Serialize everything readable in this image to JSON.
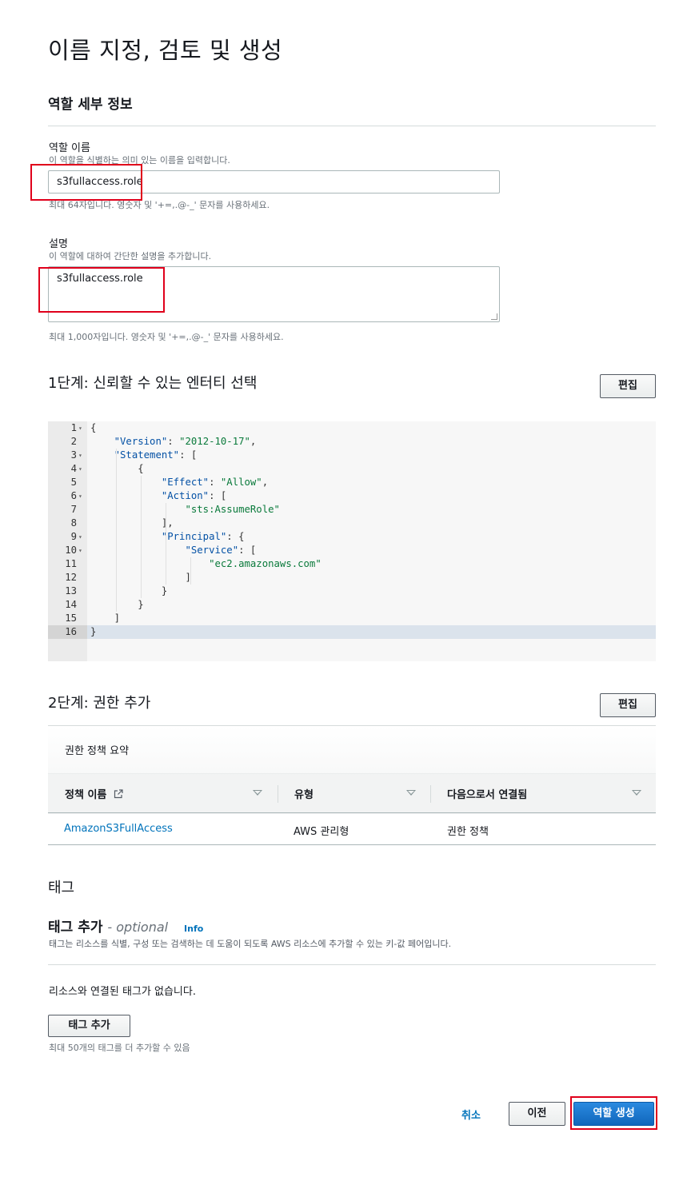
{
  "page_title": "이름 지정, 검토 및 생성",
  "role_details": {
    "heading": "역할 세부 정보",
    "name_label": "역할 이름",
    "name_desc": "이 역할을 식별하는 의미 있는 이름을 입력합니다.",
    "name_value": "s3fullaccess.role",
    "name_hint": "최대 64자입니다. 영숫자 및 '+=,.@-_' 문자를 사용하세요.",
    "desc_label": "설명",
    "desc_desc": "이 역할에 대하여 간단한 설명을 추가합니다.",
    "desc_value": "s3fullaccess.role",
    "desc_hint": "최대 1,000자입니다. 영숫자 및 '+=,.@-_' 문자를 사용하세요."
  },
  "step1": {
    "title": "1단계: 신뢰할 수 있는 엔터티 선택",
    "edit_label": "편집",
    "code_lines": [
      {
        "n": "1",
        "fold": true,
        "text": "{"
      },
      {
        "n": "2",
        "fold": false,
        "text": "    \"Version\": \"2012-10-17\","
      },
      {
        "n": "3",
        "fold": true,
        "text": "    \"Statement\": ["
      },
      {
        "n": "4",
        "fold": true,
        "text": "        {"
      },
      {
        "n": "5",
        "fold": false,
        "text": "            \"Effect\": \"Allow\","
      },
      {
        "n": "6",
        "fold": true,
        "text": "            \"Action\": ["
      },
      {
        "n": "7",
        "fold": false,
        "text": "                \"sts:AssumeRole\""
      },
      {
        "n": "8",
        "fold": false,
        "text": "            ],"
      },
      {
        "n": "9",
        "fold": true,
        "text": "            \"Principal\": {"
      },
      {
        "n": "10",
        "fold": true,
        "text": "                \"Service\": ["
      },
      {
        "n": "11",
        "fold": false,
        "text": "                    \"ec2.amazonaws.com\""
      },
      {
        "n": "12",
        "fold": false,
        "text": "                ]"
      },
      {
        "n": "13",
        "fold": false,
        "text": "            }"
      },
      {
        "n": "14",
        "fold": false,
        "text": "        }"
      },
      {
        "n": "15",
        "fold": false,
        "text": "    ]"
      },
      {
        "n": "16",
        "fold": false,
        "text": "}"
      }
    ]
  },
  "step2": {
    "title": "2단계: 권한 추가",
    "edit_label": "편집",
    "table_caption": "권한 정책 요약",
    "columns": [
      "정책 이름",
      "유형",
      "다음으로서 연결됨"
    ],
    "rows": [
      {
        "policy": "AmazonS3FullAccess",
        "type": "AWS 관리형",
        "attached_as": "권한 정책"
      }
    ]
  },
  "tags": {
    "title": "태그",
    "add_title": "태그 추가",
    "optional": "- optional",
    "info": "Info",
    "desc": "태그는 리소스를 식별, 구성 또는 검색하는 데 도움이 되도록 AWS 리소스에 추가할 수 있는 키-값 페어입니다.",
    "empty": "리소스와 연결된 태그가 없습니다.",
    "add_button": "태그 추가",
    "limit": "최대 50개의 태그를 더 추가할 수 있음"
  },
  "footer": {
    "cancel": "취소",
    "previous": "이전",
    "create": "역할 생성"
  },
  "colors": {
    "primary": "#1a73c8",
    "link": "#0073bb",
    "highlight": "#e0001b"
  }
}
